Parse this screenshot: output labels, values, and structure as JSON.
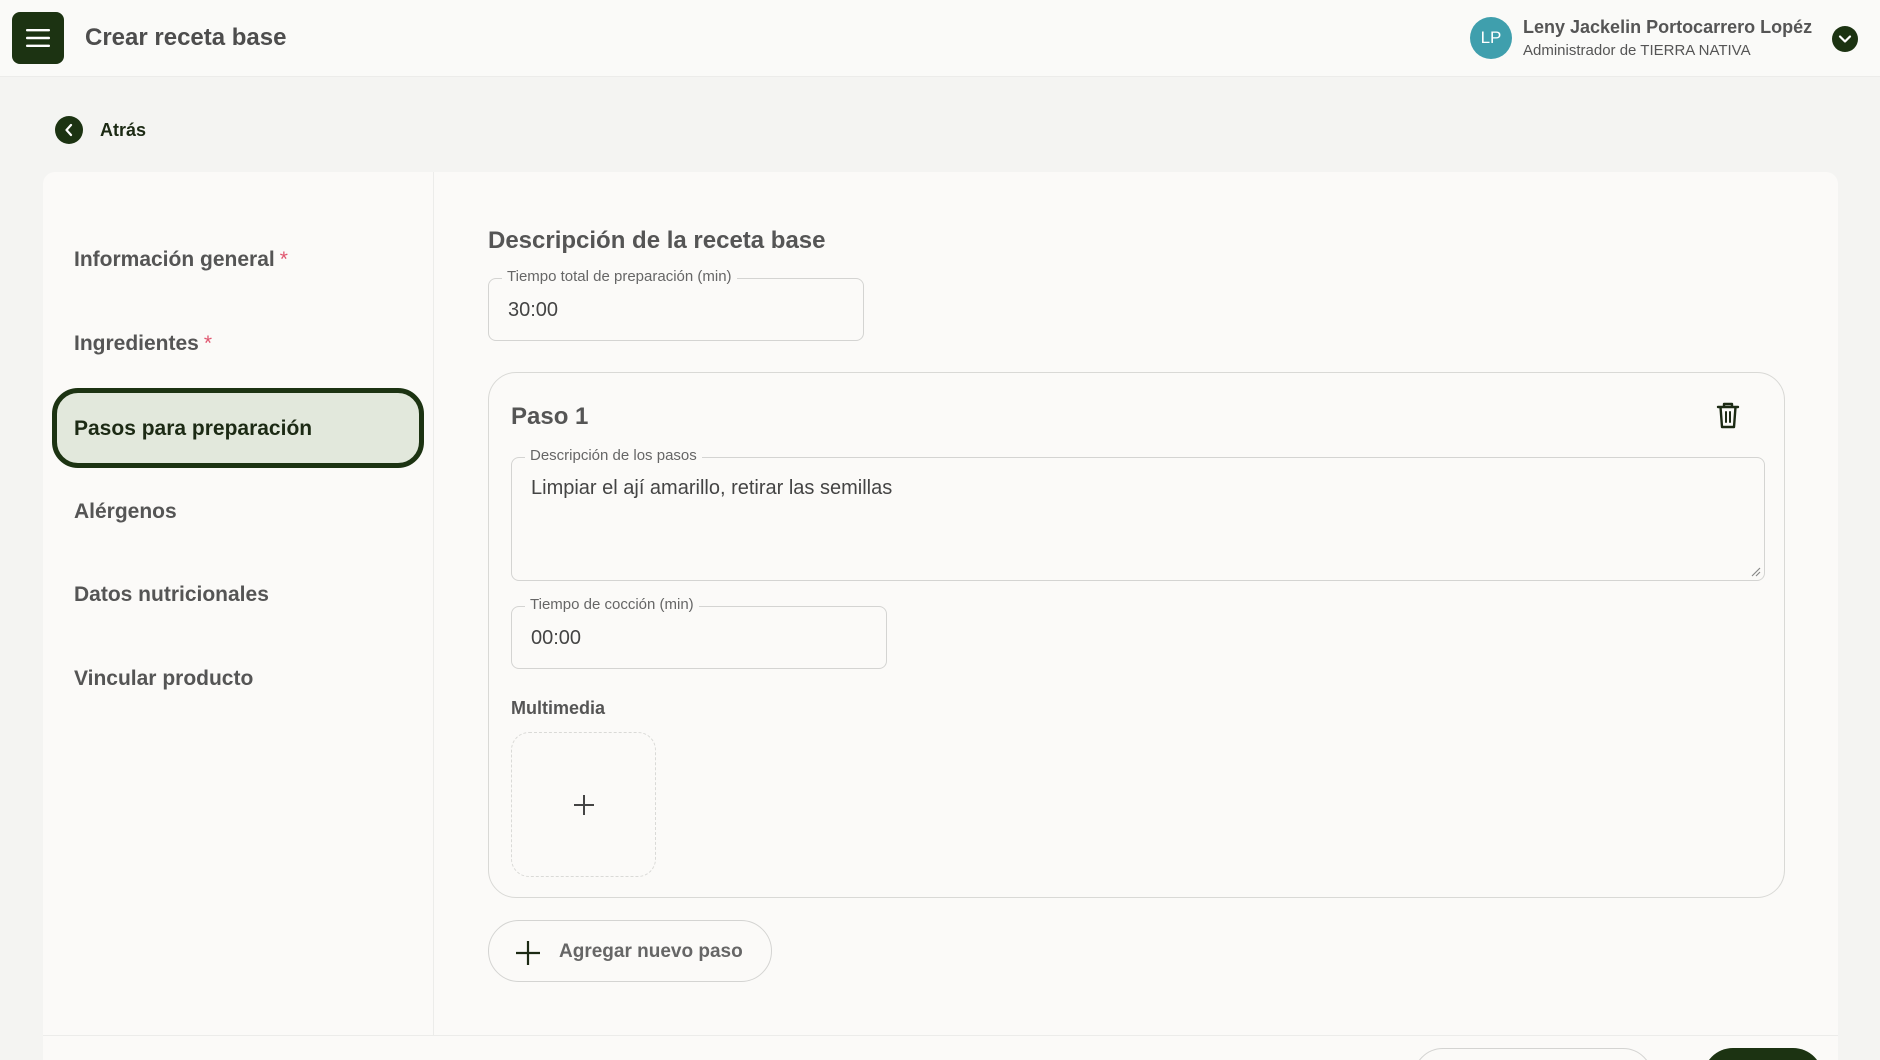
{
  "header": {
    "title": "Crear receta base",
    "user": {
      "initials": "LP",
      "name": "Leny Jackelin Portocarrero Lopéz",
      "role": "Administrador de TIERRA NATIVA"
    }
  },
  "back": {
    "label": "Atrás"
  },
  "sidebar": {
    "items": [
      {
        "label": "Información general",
        "required": "*"
      },
      {
        "label": "Ingredientes",
        "required": "*"
      },
      {
        "label": "Pasos para preparación"
      },
      {
        "label": "Alérgenos"
      },
      {
        "label": "Datos nutricionales"
      },
      {
        "label": "Vincular producto"
      }
    ],
    "active_index": 2
  },
  "main": {
    "section_title": "Descripción de la receta base",
    "total_time": {
      "label": "Tiempo total de preparación (min)",
      "value": "30:00"
    },
    "steps": [
      {
        "title": "Paso 1",
        "description": {
          "label": "Descripción de los pasos",
          "value": "Limpiar el ají amarillo, retirar las semillas"
        },
        "cook_time": {
          "label": "Tiempo de cocción (min)",
          "value": "00:00"
        },
        "multimedia_label": "Multimedia"
      }
    ],
    "add_step_label": "Agregar nuevo paso"
  },
  "colors": {
    "brand_dark_green": "#1c3312",
    "active_bg": "#e2e8dc",
    "required_mark": "#e0566f",
    "avatar_bg": "#3f9fad"
  },
  "icons": {
    "menu": "hamburger-icon",
    "user_menu": "chevron-down-icon",
    "back": "chevron-left-icon",
    "delete_step": "trash-icon",
    "add_media": "plus-icon",
    "add_step": "plus-icon"
  }
}
